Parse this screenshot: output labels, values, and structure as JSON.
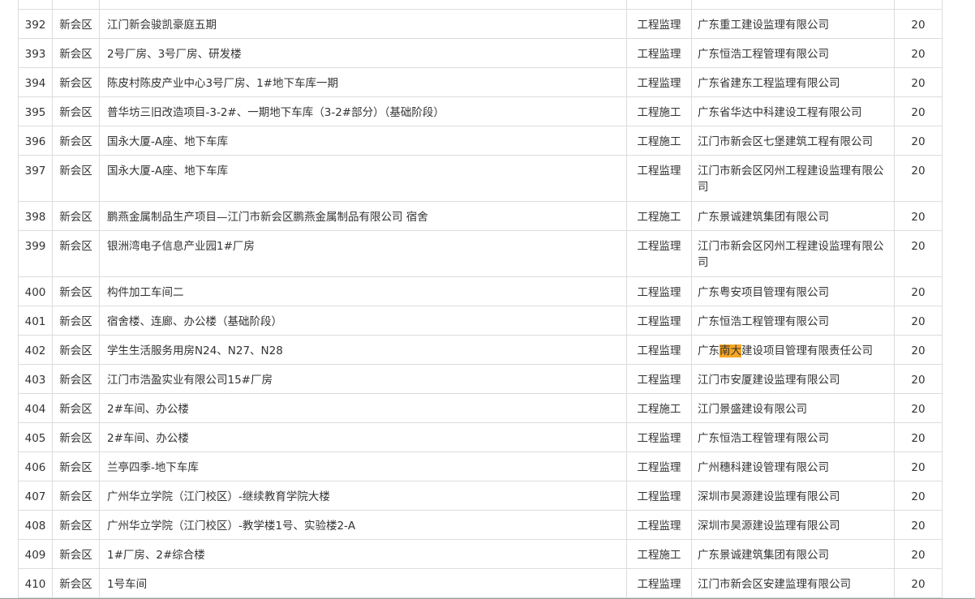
{
  "table": {
    "rows": [
      {
        "no": "392",
        "area": "新会区",
        "project": "江门新会骏凯豪庭五期",
        "type": "工程监理",
        "company": "广东重工建设监理有限公司",
        "score": "20"
      },
      {
        "no": "393",
        "area": "新会区",
        "project": "2号厂房、3号厂房、研发楼",
        "type": "工程监理",
        "company": "广东恒浩工程管理有限公司",
        "score": "20"
      },
      {
        "no": "394",
        "area": "新会区",
        "project": "陈皮村陈皮产业中心3号厂房、1#地下车库一期",
        "type": "工程监理",
        "company": "广东省建东工程监理有限公司",
        "score": "20"
      },
      {
        "no": "395",
        "area": "新会区",
        "project": "普华坊三旧改造项目-3-2#、一期地下车库（3-2#部分）（基础阶段）",
        "type": "工程施工",
        "company": "广东省华达中科建设工程有限公司",
        "score": "20"
      },
      {
        "no": "396",
        "area": "新会区",
        "project": "国永大厦-A座、地下车库",
        "type": "工程施工",
        "company": "江门市新会区七堡建筑工程有限公司",
        "score": "20"
      },
      {
        "no": "397",
        "area": "新会区",
        "project": "国永大厦-A座、地下车库",
        "type": "工程监理",
        "company": "江门市新会区冈州工程建设监理有限公司",
        "score": "20"
      },
      {
        "no": "398",
        "area": "新会区",
        "project": "鹏燕金属制品生产项目—江门市新会区鹏燕金属制品有限公司 宿舍",
        "type": "工程施工",
        "company": "广东景诚建筑集团有限公司",
        "score": "20"
      },
      {
        "no": "399",
        "area": "新会区",
        "project": "银洲湾电子信息产业园1#厂房",
        "type": "工程监理",
        "company": "江门市新会区冈州工程建设监理有限公司",
        "score": "20"
      },
      {
        "no": "400",
        "area": "新会区",
        "project": "构件加工车间二",
        "type": "工程监理",
        "company": "广东粤安项目管理有限公司",
        "score": "20"
      },
      {
        "no": "401",
        "area": "新会区",
        "project": "宿舍楼、连廊、办公楼（基础阶段）",
        "type": "工程监理",
        "company": "广东恒浩工程管理有限公司",
        "score": "20"
      },
      {
        "no": "402",
        "area": "新会区",
        "project": "学生生活服务用房N24、N27、N28",
        "type": "工程监理",
        "company_pre": "广东",
        "company_hl": "南大",
        "company_post": "建设项目管理有限责任公司",
        "score": "20"
      },
      {
        "no": "403",
        "area": "新会区",
        "project": "江门市浩盈实业有限公司15#厂房",
        "type": "工程监理",
        "company": "江门市安厦建设监理有限公司",
        "score": "20"
      },
      {
        "no": "404",
        "area": "新会区",
        "project": "2#车间、办公楼",
        "type": "工程施工",
        "company": "江门景盛建设有限公司",
        "score": "20"
      },
      {
        "no": "405",
        "area": "新会区",
        "project": "2#车间、办公楼",
        "type": "工程监理",
        "company": "广东恒浩工程管理有限公司",
        "score": "20"
      },
      {
        "no": "406",
        "area": "新会区",
        "project": "兰亭四季-地下车库",
        "type": "工程监理",
        "company": "广州穗科建设管理有限公司",
        "score": "20"
      },
      {
        "no": "407",
        "area": "新会区",
        "project": "广州华立学院（江门校区）-继续教育学院大楼",
        "type": "工程监理",
        "company": "深圳市昊源建设监理有限公司",
        "score": "20"
      },
      {
        "no": "408",
        "area": "新会区",
        "project": "广州华立学院（江门校区）-教学楼1号、实验楼2-A",
        "type": "工程监理",
        "company": "深圳市昊源建设监理有限公司",
        "score": "20"
      },
      {
        "no": "409",
        "area": "新会区",
        "project": "1#厂房、2#综合楼",
        "type": "工程施工",
        "company": "广东景诚建筑集团有限公司",
        "score": "20"
      },
      {
        "no": "410",
        "area": "新会区",
        "project": "1号车间",
        "type": "工程监理",
        "company": "江门市新会区安建监理有限公司",
        "score": "20"
      }
    ]
  },
  "colors": {
    "highlight": "#f5a623",
    "border": "#dcdcdc",
    "text": "#333333"
  }
}
